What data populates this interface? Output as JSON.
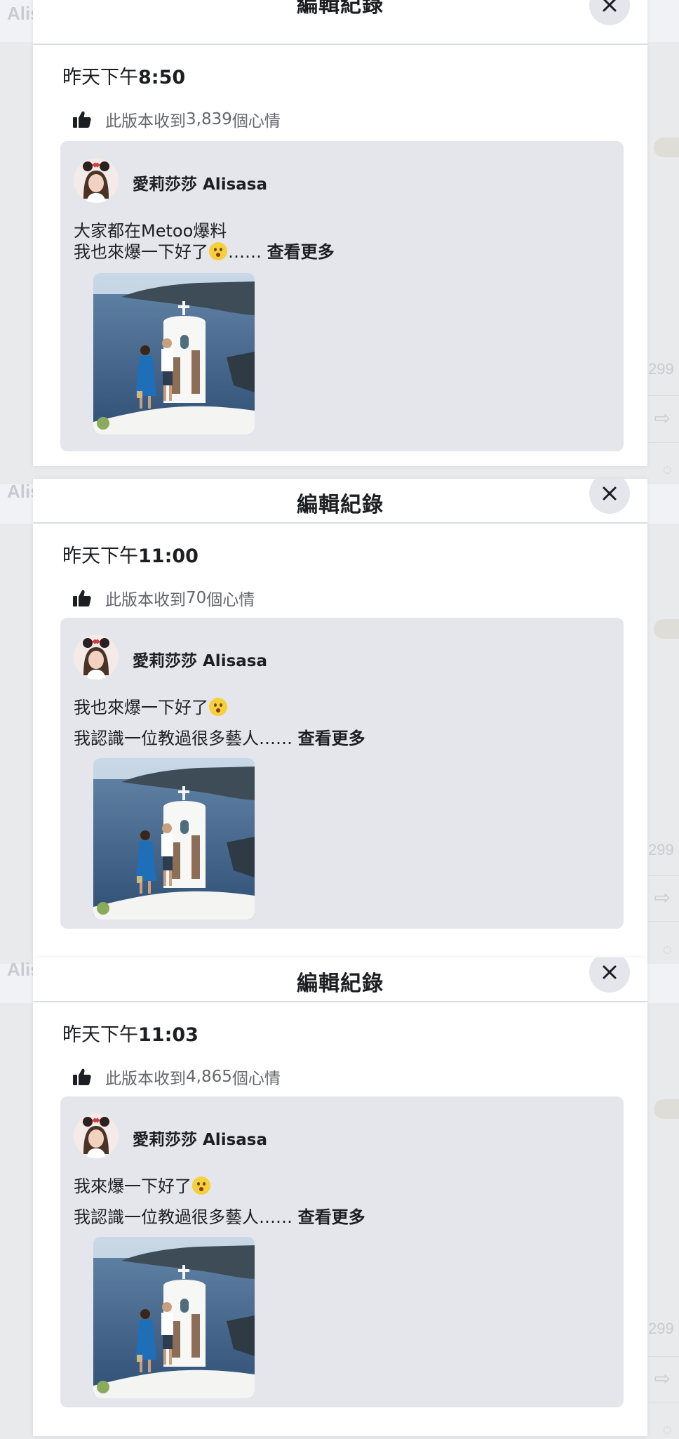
{
  "background_page": {
    "author_fragment": "Alis",
    "count_fragment": "299",
    "share_fragment": "⇨",
    "comment_fragment": "◌"
  },
  "edit_history": {
    "title": "編輯紀錄",
    "close_icon": "close-icon",
    "reactions_prefix": "此版本收到",
    "reactions_suffix": "個心情",
    "see_more": "查看更多",
    "author": "愛莉莎莎 Alisasa",
    "versions": [
      {
        "date": "昨天下午",
        "clock": "8:50",
        "reaction_count": "3,839",
        "line1": "大家都在Metoo爆料",
        "line2_before": "我也來爆一下好了",
        "line2_after": "……",
        "line2_has_more": true,
        "line1_has_emoji": false
      },
      {
        "date": "昨天下午",
        "clock": "11:00",
        "reaction_count": "70",
        "line1": "我也來爆一下好了",
        "line2_before": "我認識一位教過很多藝人……",
        "line2_after": "",
        "line2_has_more": true,
        "line1_has_emoji": true
      },
      {
        "date": "昨天下午",
        "clock": "11:03",
        "reaction_count": "4,865",
        "line1": "我來爆一下好了",
        "line2_before": "我認識一位教過很多藝人……",
        "line2_after": "",
        "line2_has_more": true,
        "line1_has_emoji": true
      }
    ]
  },
  "colors": {
    "overlay": "#e9eaec",
    "card": "#e4e6eb",
    "secondary_text": "#65676b",
    "primary_text": "#1c1e21"
  }
}
